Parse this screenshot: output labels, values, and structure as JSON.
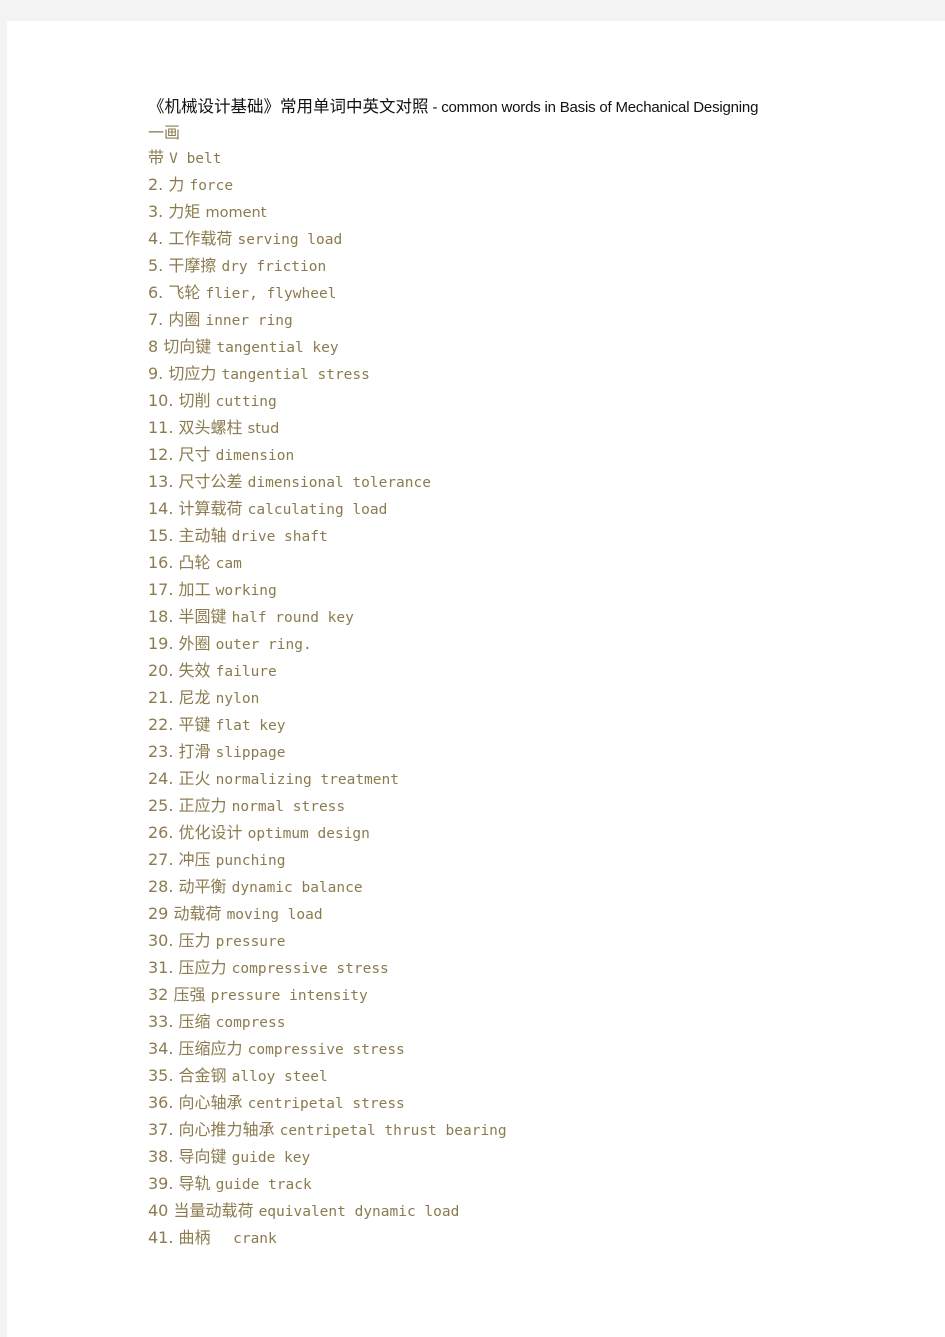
{
  "document": {
    "title_cjk": "《机械设计基础》常用单词中英文对照",
    "title_latin": " - common words in Basis of Mechanical Designing",
    "section_heading": "一画",
    "text_color": "#8b7b4f",
    "title_color": "#111111",
    "page_background": "#ffffff",
    "backdrop_color": "#f3f3f3"
  },
  "entries": [
    {
      "num": "",
      "cjk": "带",
      "en": "V belt",
      "style": "mono"
    },
    {
      "num": "2.",
      "cjk": "力",
      "en": "force",
      "style": "mono"
    },
    {
      "num": "3.",
      "cjk": "力矩",
      "en": "moment",
      "style": "narrow"
    },
    {
      "num": "4.",
      "cjk": "工作载荷",
      "en": "serving load",
      "style": "mono"
    },
    {
      "num": "5.",
      "cjk": "干摩擦",
      "en": "dry friction",
      "style": "mono"
    },
    {
      "num": "6.",
      "cjk": "飞轮",
      "en": "flier, flywheel",
      "style": "mono"
    },
    {
      "num": "7.",
      "cjk": "内圈",
      "en": "inner ring",
      "style": "mono"
    },
    {
      "num": "8",
      "cjk": "切向键",
      "en": "tangential key",
      "style": "mono"
    },
    {
      "num": "9.",
      "cjk": "切应力",
      "en": "tangential stress",
      "style": "mono"
    },
    {
      "num": "10.",
      "cjk": "切削",
      "en": "cutting",
      "style": "mono"
    },
    {
      "num": "11.",
      "cjk": "双头螺柱",
      "en": "stud",
      "style": "narrow"
    },
    {
      "num": "12.",
      "cjk": "尺寸",
      "en": "dimension",
      "style": "mono"
    },
    {
      "num": "13.",
      "cjk": "尺寸公差",
      "en": "dimensional tolerance",
      "style": "mono"
    },
    {
      "num": "14.",
      "cjk": "计算载荷",
      "en": "calculating load",
      "style": "mono"
    },
    {
      "num": "15.",
      "cjk": "主动轴",
      "en": "drive shaft",
      "style": "mono"
    },
    {
      "num": "16.",
      "cjk": "凸轮",
      "en": "cam",
      "style": "mono"
    },
    {
      "num": "17.",
      "cjk": "加工",
      "en": "working",
      "style": "mono"
    },
    {
      "num": "18.",
      "cjk": "半圆键",
      "en": "half round key",
      "style": "mono"
    },
    {
      "num": "19.",
      "cjk": "外圈",
      "en": "outer ring.",
      "style": "mono"
    },
    {
      "num": "20.",
      "cjk": "失效",
      "en": "failure",
      "style": "mono"
    },
    {
      "num": "21.",
      "cjk": "尼龙",
      "en": "nylon",
      "style": "mono"
    },
    {
      "num": "22.",
      "cjk": "平键",
      "en": "flat key",
      "style": "mono"
    },
    {
      "num": "23.",
      "cjk": "打滑",
      "en": "slippage",
      "style": "mono"
    },
    {
      "num": "24.",
      "cjk": "正火",
      "en": "normalizing treatment",
      "style": "mono"
    },
    {
      "num": "25.",
      "cjk": "正应力",
      "en": "normal stress",
      "style": "mono"
    },
    {
      "num": "26.",
      "cjk": "优化设计",
      "en": "optimum design",
      "style": "mono"
    },
    {
      "num": "27.",
      "cjk": "冲压",
      "en": "punching",
      "style": "mono"
    },
    {
      "num": "28.",
      "cjk": "动平衡",
      "en": "dynamic balance",
      "style": "mono"
    },
    {
      "num": "29",
      "cjk": "动载荷",
      "en": "moving load",
      "style": "mono"
    },
    {
      "num": "30.",
      "cjk": "压力",
      "en": "pressure",
      "style": "mono"
    },
    {
      "num": "31.",
      "cjk": "压应力",
      "en": "compressive stress",
      "style": "mono"
    },
    {
      "num": "32",
      "cjk": "压强",
      "en": "pressure intensity",
      "style": "mono"
    },
    {
      "num": "33.",
      "cjk": "压缩",
      "en": "compress",
      "style": "mono"
    },
    {
      "num": "34.",
      "cjk": "压缩应力",
      "en": "compressive stress",
      "style": "mono"
    },
    {
      "num": "35.",
      "cjk": "合金钢",
      "en": "alloy steel",
      "style": "mono"
    },
    {
      "num": "36.",
      "cjk": "向心轴承",
      "en": "centripetal stress",
      "style": "mono"
    },
    {
      "num": "37.",
      "cjk": "向心推力轴承",
      "en": "centripetal thrust bearing",
      "style": "mono"
    },
    {
      "num": "38.",
      "cjk": "导向键",
      "en": "guide key",
      "style": "mono"
    },
    {
      "num": "39.",
      "cjk": "导轨",
      "en": "guide track",
      "style": "mono"
    },
    {
      "num": "40",
      "cjk": "当量动载荷",
      "en": "equivalent dynamic load",
      "style": "mono"
    },
    {
      "num": "41.",
      "cjk": "曲柄",
      "en": "  crank",
      "style": "mono"
    }
  ]
}
